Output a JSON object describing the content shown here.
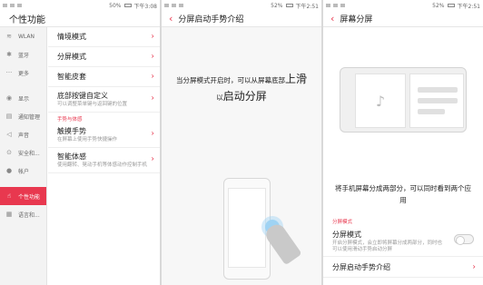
{
  "status_bars": [
    {
      "signal": "50%",
      "time": "下午3:08"
    },
    {
      "signal": "52%",
      "time": "下午2:51"
    },
    {
      "signal": "52%",
      "time": "下午2:51"
    }
  ],
  "panel1": {
    "title": "个性功能",
    "sidebar": [
      {
        "icon": "≋",
        "label": "WLAN"
      },
      {
        "icon": "✱",
        "label": "蓝牙"
      },
      {
        "icon": "···",
        "label": "更多"
      },
      {
        "icon": "◉",
        "label": "显示"
      },
      {
        "icon": "▤",
        "label": "通知管理"
      },
      {
        "icon": "◁",
        "label": "声音"
      },
      {
        "icon": "⊙",
        "label": "安全和..."
      },
      {
        "icon": "●",
        "label": "帐户"
      },
      {
        "icon": "☝",
        "label": "个性功能"
      },
      {
        "icon": "▦",
        "label": "语言和..."
      }
    ],
    "items": [
      {
        "title": "情境模式",
        "subtitle": ""
      },
      {
        "title": "分屏模式",
        "subtitle": ""
      },
      {
        "title": "智能皮套",
        "subtitle": ""
      },
      {
        "title": "底部按键自定义",
        "subtitle": "可以调整菜单键与返回键的位置"
      }
    ],
    "section": "手势与体感",
    "section_items": [
      {
        "title": "触摸手势",
        "subtitle": "在屏幕上使用手势快捷操作"
      },
      {
        "title": "智能体感",
        "subtitle": "使用翻转、晃动手机等体感动作控制手机"
      }
    ]
  },
  "panel2": {
    "title": "分屏启动手势介绍",
    "line1_small": "当分屏模式开启时，可以从屏幕底部",
    "line1_big": "上滑",
    "line2_small": "以",
    "line2_big": "启动分屏"
  },
  "panel3": {
    "title": "屏幕分屏",
    "illustration_icon": "♪",
    "description": "将手机屏幕分成两部分，可以同时看到两个应用",
    "section": "分屏模式",
    "mode_title": "分屏模式",
    "mode_subtitle": "开启分屏模式，会立即将屏幕分成两部分，同时也可以使用滑动手势启动分屏",
    "gesture_link": "分屏启动手势介绍"
  }
}
